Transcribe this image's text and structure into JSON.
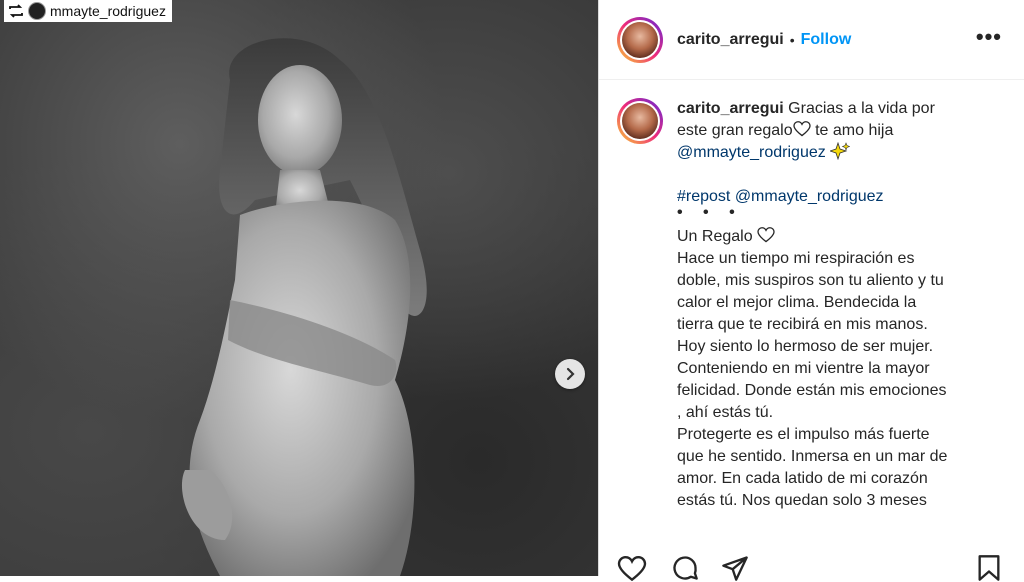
{
  "post": {
    "repost_handle": "mmayte_rodriguez"
  },
  "header": {
    "username": "carito_arregui",
    "separator": "•",
    "follow_label": "Follow",
    "more_label": "•••"
  },
  "caption": {
    "username": "carito_arregui",
    "line1": "Gracias a la vida por",
    "line2": "este gran regalo",
    "line2b": " te amo hija",
    "mention1": "@mmayte_rodriguez",
    "hashtag_line": "#repost @mmayte_rodriguez",
    "ellipsis": "• • •",
    "title": "Un Regalo",
    "body": [
      "Hace un tiempo mi respiración es",
      "doble, mis suspiros son tu aliento y tu",
      "calor el mejor clima. Bendecida la",
      "tierra que te recibirá en mis manos.",
      "Hoy siento lo hermoso de ser mujer.",
      "Conteniendo en mi vientre la mayor",
      "felicidad. Donde están mis emociones",
      ", ahí estás tú.",
      "Protegerte es el impulso más fuerte",
      "que he sentido. Inmersa en un mar de",
      "amor. En cada latido de mi corazón",
      "estás tú. Nos quedan solo 3 meses"
    ]
  },
  "icons": {
    "repost": "repost-icon",
    "next": "chevron-right-icon",
    "heart": "heart-icon",
    "comment": "comment-icon",
    "share": "share-icon",
    "save": "bookmark-icon"
  },
  "colors": {
    "follow": "#0095f6",
    "mention": "#00376b",
    "text": "#262626"
  }
}
